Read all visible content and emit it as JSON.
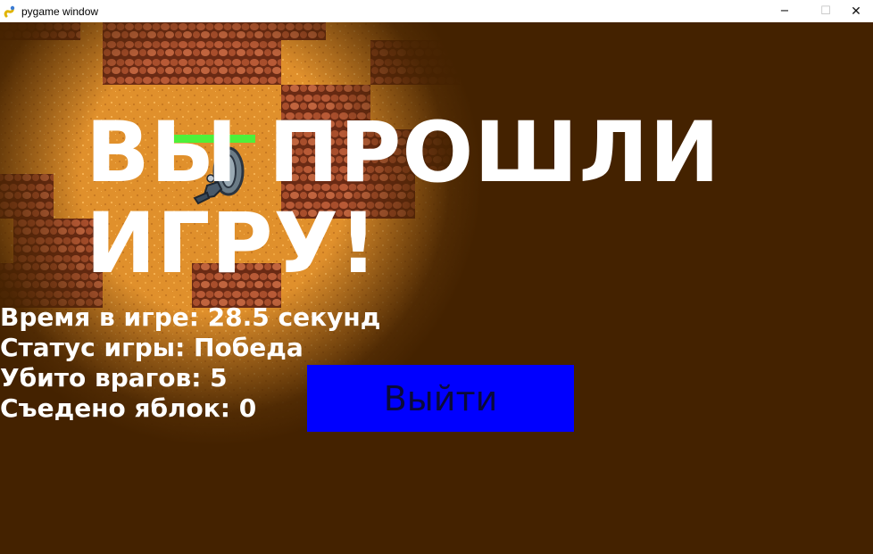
{
  "window": {
    "title": "pygame window",
    "icon": "pygame-snake-icon",
    "controls": {
      "minimize_glyph": "−",
      "maximize_glyph": "☐",
      "close_glyph": "✕"
    }
  },
  "game": {
    "background_color": "#442200",
    "player_health_fraction": 1.0,
    "headline": "ВЫ ПРОШЛИ ИГРУ!",
    "stats": [
      "Время в игре: 28.5 секунд",
      "Статус игры: Победа",
      "Убито врагов: 5",
      "Съедено яблок: 0"
    ],
    "exit_button": {
      "label": "Выйти",
      "color": "#0000ff"
    }
  }
}
